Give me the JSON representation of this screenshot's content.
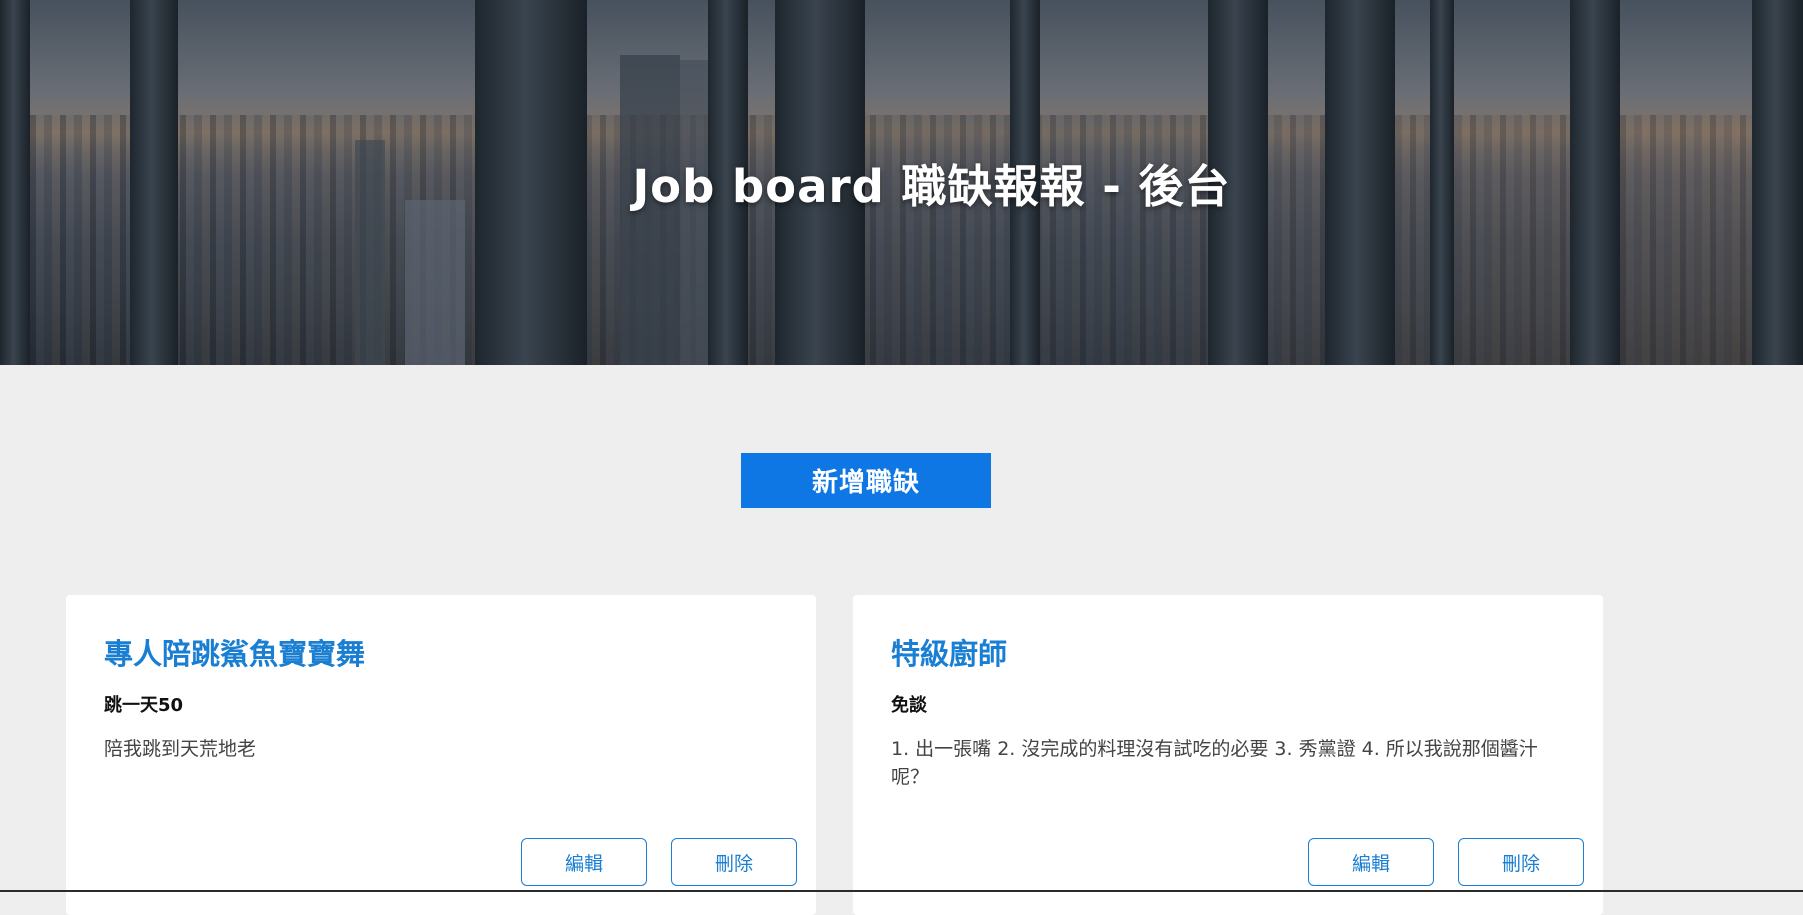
{
  "hero": {
    "title": "Job board 職缺報報 - 後台"
  },
  "actions": {
    "add_job_label": "新增職缺"
  },
  "jobs": [
    {
      "title": "專人陪跳鯊魚寶寶舞",
      "salary": "跳一天50",
      "description": "陪我跳到天荒地老",
      "edit_label": "編輯",
      "delete_label": "刪除"
    },
    {
      "title": "特級廚師",
      "salary": "免談",
      "description": "1. 出一張嘴 2. 沒完成的料理沒有試吃的必要 3. 秀黨證 4. 所以我說那個醬汁呢？",
      "edit_label": "編輯",
      "delete_label": "刪除"
    }
  ],
  "colors": {
    "primary": "#0e77e4",
    "link": "#1a7fd2",
    "background": "#eeeeee",
    "card": "#ffffff"
  }
}
